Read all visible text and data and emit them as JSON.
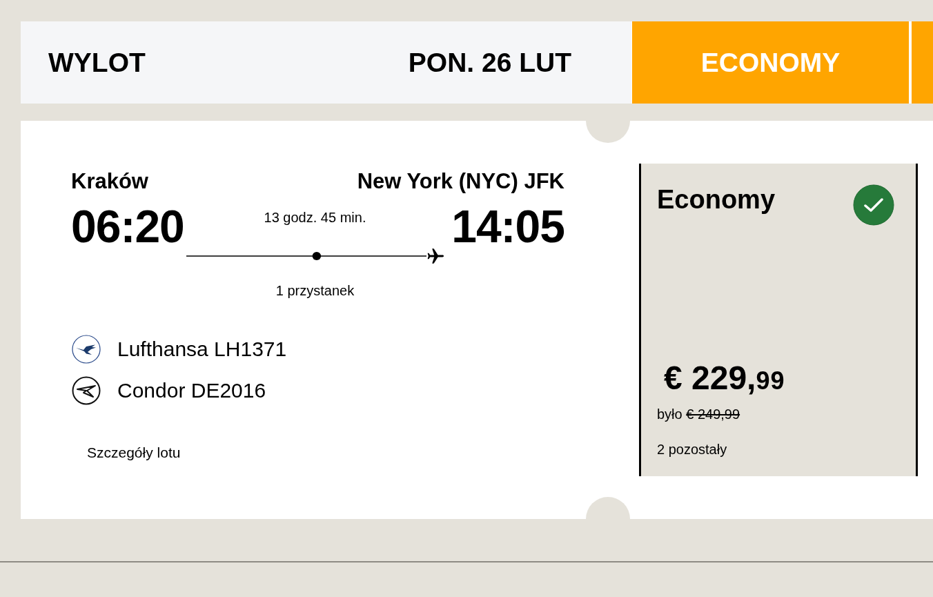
{
  "header": {
    "direction": "WYLOT",
    "date": "PON. 26 LUT",
    "fare_columns": [
      {
        "label": "ECONOMY"
      }
    ]
  },
  "flight": {
    "origin": {
      "city": "Kraków",
      "time": "06:20"
    },
    "destination": {
      "city": "New York (NYC) JFK",
      "time": "14:05"
    },
    "duration": "13 godz. 45 min.",
    "stops": "1 przystanek",
    "segments": [
      {
        "kind": "crane",
        "label": "Lufthansa LH1371"
      },
      {
        "kind": "wing",
        "label": "Condor DE2016"
      }
    ],
    "details_link": "Szczegóły lotu"
  },
  "fare": {
    "name": "Economy",
    "selected": true,
    "price_main": "€ 229,",
    "price_fraction": "99",
    "was_label": "było",
    "was_price": "€ 249,99",
    "seats_left": "2 pozostały"
  }
}
